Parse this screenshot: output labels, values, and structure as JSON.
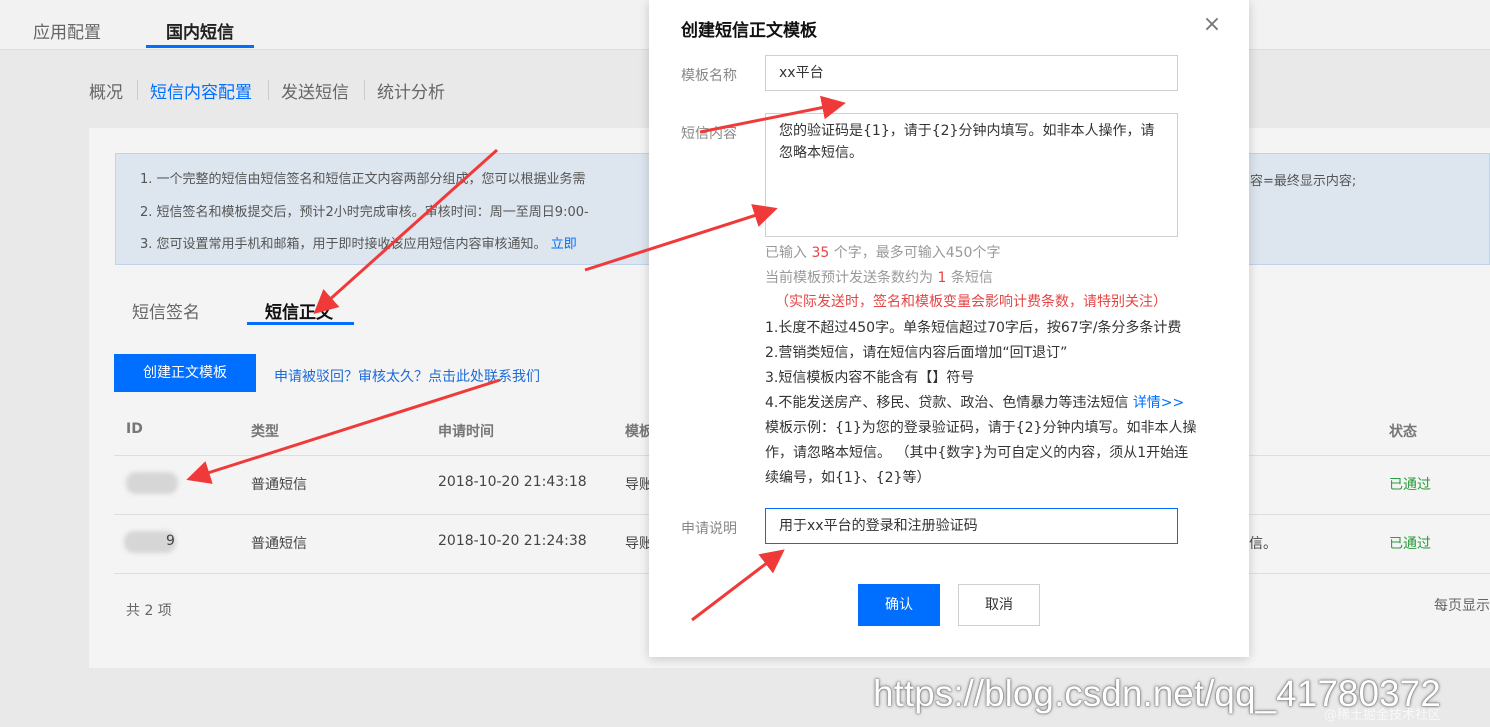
{
  "topnav": {
    "items": [
      "应用配置",
      "国内短信"
    ],
    "active": 1
  },
  "subnav": {
    "items": [
      "概况",
      "短信内容配置",
      "发送短信",
      "统计分析"
    ]
  },
  "notice": {
    "line1": "1. 一个完整的短信由短信签名和短信正文内容两部分组成，您可以根据业务需",
    "line1_tail": "容=最终显示内容;",
    "line2": "2. 短信签名和模板提交后，预计2小时完成审核。审核时间：周一至周日9:00-",
    "line3": "3. 您可设置常用手机和邮箱，用于即时接收该应用短信内容审核通知。",
    "line3_link": "立即"
  },
  "tabs": [
    "短信签名",
    "短信正文"
  ],
  "create_button": "创建正文模板",
  "help_link": "申请被驳回？审核太久？点击此处联系我们",
  "table": {
    "headers": [
      "ID",
      "类型",
      "申请时间",
      "模板",
      "状态"
    ],
    "rows": [
      {
        "id": "",
        "type": "普通短信",
        "time": "2018-10-20 21:43:18",
        "content": "导账",
        "tail": "",
        "status": "已通过"
      },
      {
        "id": "9",
        "type": "普通短信",
        "time": "2018-10-20 21:24:38",
        "content": "导账",
        "tail": "信。",
        "status": "已通过"
      }
    ],
    "total": "共 2 项",
    "per_page": "每页显示"
  },
  "modal": {
    "title": "创建短信正文模板",
    "name_label": "模板名称",
    "name_value": "xx平台",
    "content_label": "短信内容",
    "content_value": "您的验证码是{1}，请于{2}分钟内填写。如非本人操作，请忽略本短信。",
    "count_prefix": "已输入 ",
    "count_value": "35",
    "count_suffix": " 个字，最多可输入450个字",
    "estimate_prefix": "当前模板预计发送条数约为 ",
    "estimate_value": "1",
    "estimate_suffix": " 条短信",
    "warning": "（实际发送时，签名和模板变量会影响计费条数，请特别关注）",
    "rules": [
      "1.长度不超过450字。单条短信超过70字后，按67字/条分多条计费",
      "2.营销类短信，请在短信内容后面增加“回T退订”",
      "3.短信模板内容不能含有【】符号",
      "4.不能发送房产、移民、贷款、政治、色情暴力等违法短信 "
    ],
    "rules_link": "详情>>",
    "example": [
      "模板示例：{1}为您的登录验证码，请于{2}分钟内填写。如非本人操",
      "作，请忽略本短信。 （其中{数字}为可自定义的内容，须从1开始连",
      "续编号，如{1}、{2}等）"
    ],
    "desc_label": "申请说明",
    "desc_value": "用于xx平台的登录和注册验证码",
    "confirm": "确认",
    "cancel": "取消"
  },
  "watermark": "https://blog.csdn.net/qq_41780372",
  "watermark_small": "@稀土掘金技术社区",
  "colors": {
    "primary": "#006eff",
    "danger": "#e54545",
    "success": "#2a9d3c",
    "arrow": "#f03a3a"
  }
}
